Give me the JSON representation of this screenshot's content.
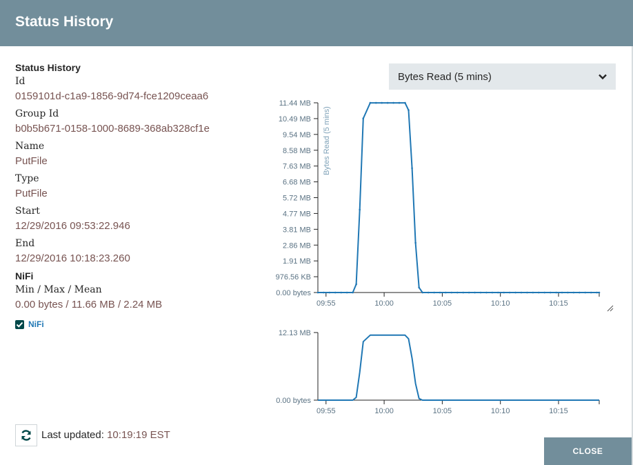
{
  "dialog": {
    "title": "Status History",
    "close_label": "CLOSE"
  },
  "details": {
    "section_title": "Status History",
    "fields": [
      {
        "label": "Id",
        "value": "0159101d-c1a9-1856-9d74-fce1209ceaa6"
      },
      {
        "label": "Group Id",
        "value": "b0b5b671-0158-1000-8689-368ab328cf1e"
      },
      {
        "label": "Name",
        "value": "PutFile"
      },
      {
        "label": "Type",
        "value": "PutFile"
      },
      {
        "label": "Start",
        "value": "12/29/2016 09:53:22.946"
      },
      {
        "label": "End",
        "value": "12/29/2016 10:18:23.260"
      }
    ]
  },
  "nifi": {
    "section_title": "NiFi",
    "stats_label": "Min / Max / Mean",
    "stats_value": "0.00 bytes / 11.66 MB / 2.24 MB",
    "legend_label": "NiFi",
    "legend_checked": true
  },
  "metric_select": {
    "selected": "Bytes Read (5 mins)"
  },
  "footer": {
    "last_updated_label": "Last updated:",
    "last_updated_time": "10:19:19 EST"
  },
  "colors": {
    "header": "#728e9b",
    "series": "#1f77b4",
    "value_text": "#775351",
    "checkbox": "#004849"
  },
  "icons": {
    "refresh": "refresh-icon",
    "chevron": "chevron-down-icon",
    "check": "check-icon",
    "resize": "resize-handle-icon"
  },
  "chart_data": [
    {
      "type": "line",
      "ylabel": "Bytes Read (5 mins)",
      "y_unit": "MB",
      "y_ticks": [
        "0.00 bytes",
        "976.56 KB",
        "1.91 MB",
        "2.86 MB",
        "3.81 MB",
        "4.77 MB",
        "5.72 MB",
        "6.68 MB",
        "7.63 MB",
        "8.58 MB",
        "9.54 MB",
        "10.49 MB",
        "11.44 MB"
      ],
      "y_tick_values": [
        0,
        0.9537,
        1.9073,
        2.861,
        3.8147,
        4.7684,
        5.722,
        6.6757,
        7.6294,
        8.583,
        9.5367,
        10.4904,
        11.444
      ],
      "ylim": [
        0,
        11.444
      ],
      "x_ticks": [
        "09:55",
        "10:00",
        "10:05",
        "10:10",
        "10:15"
      ],
      "x_tick_values": [
        595,
        600,
        605,
        610,
        615
      ],
      "xlim": [
        594.3,
        618.5
      ],
      "grid": false,
      "series": [
        {
          "x": [
            594.3,
            594.8,
            595.3,
            595.8,
            596.3,
            596.8,
            597.3,
            597.6,
            597.9,
            598.2,
            598.8,
            599.3,
            599.8,
            600.3,
            600.8,
            601.3,
            601.8,
            602.1,
            602.4,
            602.7,
            603.0,
            603.3,
            603.8,
            604.3,
            604.8,
            605.3,
            605.8,
            606.3,
            606.8,
            607.3,
            607.8,
            608.3,
            608.8,
            609.3,
            609.8,
            610.3,
            610.8,
            611.3,
            611.8,
            612.3,
            612.8,
            613.3,
            613.8,
            614.3,
            614.8,
            615.3,
            615.8,
            616.3,
            616.8,
            617.3,
            617.8,
            618.3,
            618.5
          ],
          "values": [
            0,
            0,
            0,
            0,
            0,
            0,
            0,
            0.5,
            5.0,
            10.5,
            11.44,
            11.44,
            11.44,
            11.44,
            11.44,
            11.44,
            11.44,
            11.0,
            7.5,
            3.0,
            0.3,
            0,
            0,
            0,
            0,
            0,
            0,
            0,
            0,
            0,
            0,
            0,
            0,
            0,
            0,
            0,
            0,
            0,
            0,
            0,
            0,
            0,
            0,
            0,
            0,
            0,
            0,
            0,
            0,
            0,
            0,
            0,
            0
          ]
        }
      ]
    },
    {
      "type": "line",
      "y_ticks": [
        "0.00 bytes",
        "12.13 MB"
      ],
      "y_tick_values": [
        0,
        12.13
      ],
      "ylim": [
        0,
        12.13
      ],
      "x_ticks": [
        "09:55",
        "10:00",
        "10:05",
        "10:10",
        "10:15"
      ],
      "x_tick_values": [
        595,
        600,
        605,
        610,
        615
      ],
      "xlim": [
        594.3,
        618.5
      ],
      "grid": false,
      "series": [
        {
          "x": [
            594.3,
            597.3,
            597.6,
            597.9,
            598.2,
            598.8,
            601.8,
            602.1,
            602.4,
            602.7,
            603.0,
            603.3,
            618.5
          ],
          "values": [
            0,
            0,
            0.5,
            5.0,
            10.5,
            11.66,
            11.66,
            11.0,
            7.5,
            3.0,
            0.3,
            0,
            0
          ]
        }
      ]
    }
  ]
}
